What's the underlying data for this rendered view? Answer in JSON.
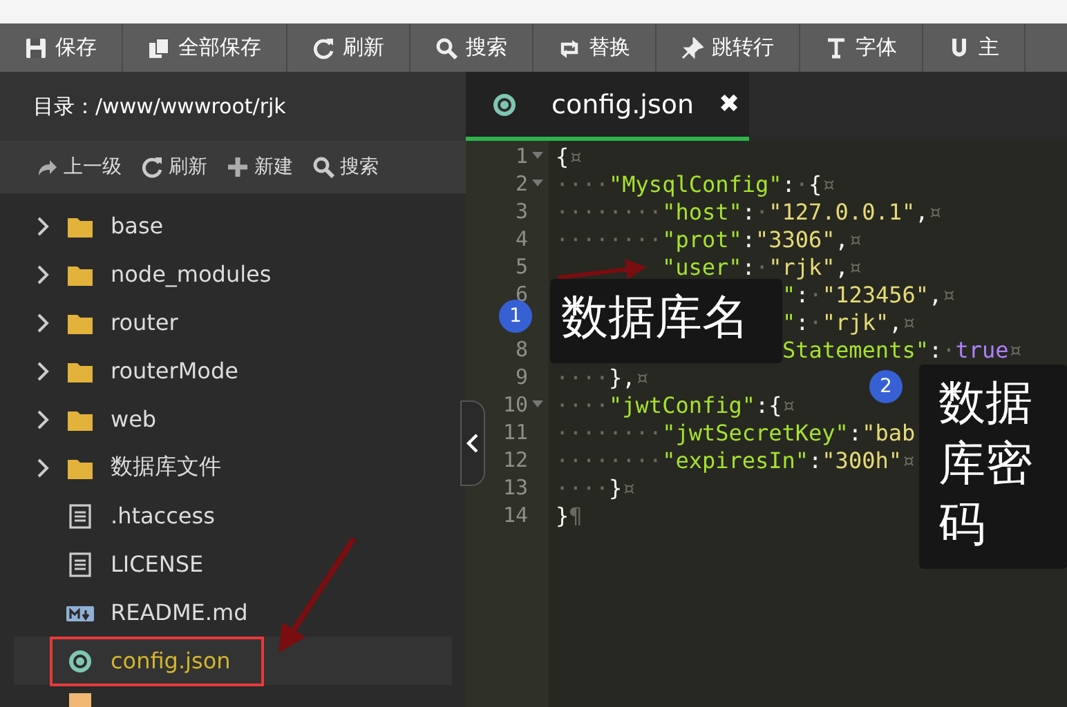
{
  "toolbar": [
    "保存",
    "全部保存",
    "刷新",
    "搜索",
    "替换",
    "跳转行",
    "字体",
    "主"
  ],
  "sidebar": {
    "path": "目录：/www/wwwroot/rjk",
    "actions": [
      "上一级",
      "刷新",
      "新建",
      "搜索"
    ],
    "items": [
      {
        "name": "base",
        "kind": "folder",
        "selected": false
      },
      {
        "name": "node_modules",
        "kind": "folder",
        "selected": false
      },
      {
        "name": "router",
        "kind": "folder",
        "selected": false
      },
      {
        "name": "routerMode",
        "kind": "folder",
        "selected": false
      },
      {
        "name": "web",
        "kind": "folder",
        "selected": false
      },
      {
        "name": "数据库文件",
        "kind": "folder",
        "selected": false
      },
      {
        "name": ".htaccess",
        "kind": "file",
        "selected": false
      },
      {
        "name": "LICENSE",
        "kind": "file",
        "selected": false
      },
      {
        "name": "README.md",
        "kind": "markdown",
        "selected": false
      },
      {
        "name": "config.json",
        "kind": "json",
        "selected": true
      }
    ],
    "more_item": {
      "kind": "js"
    }
  },
  "editor": {
    "tab": {
      "title": "config.json",
      "close": "✖"
    },
    "lines": [
      {
        "n": "1",
        "fold": true,
        "kind": "full",
        "seg": [
          {
            "kind": "punct",
            "text": "{"
          },
          {
            "kind": "ws",
            "text": "¤"
          }
        ]
      },
      {
        "n": "2",
        "fold": true,
        "kind": "full",
        "seg": [
          {
            "kind": "ws",
            "text": "····"
          },
          {
            "kind": "key",
            "text": "\"MysqlConfig\""
          },
          {
            "kind": "punct",
            "text": ":"
          },
          {
            "kind": "ws",
            "text": "·"
          },
          {
            "kind": "punct",
            "text": "{"
          },
          {
            "kind": "ws",
            "text": "¤"
          }
        ]
      },
      {
        "n": "3",
        "fold": false,
        "kind": "full",
        "seg": [
          {
            "kind": "ws",
            "text": "········"
          },
          {
            "kind": "key",
            "text": "\"host\""
          },
          {
            "kind": "punct",
            "text": ":"
          },
          {
            "kind": "ws",
            "text": "·"
          },
          {
            "kind": "str",
            "text": "\"127.0.0.1\""
          },
          {
            "kind": "punct",
            "text": ","
          },
          {
            "kind": "ws",
            "text": "¤"
          }
        ]
      },
      {
        "n": "4",
        "fold": false,
        "kind": "full",
        "seg": [
          {
            "kind": "ws",
            "text": "········"
          },
          {
            "kind": "key",
            "text": "\"prot\""
          },
          {
            "kind": "punct",
            "text": ":"
          },
          {
            "kind": "str",
            "text": "\"3306\""
          },
          {
            "kind": "punct",
            "text": ","
          },
          {
            "kind": "ws",
            "text": "¤"
          }
        ]
      },
      {
        "n": "5",
        "fold": false,
        "kind": "shifted",
        "seg": [
          {
            "kind": "key",
            "text": "\"user\""
          },
          {
            "kind": "punct",
            "text": ":"
          },
          {
            "kind": "ws",
            "text": "·"
          },
          {
            "kind": "str",
            "text": "\"rjk\""
          },
          {
            "kind": "punct",
            "text": ","
          },
          {
            "kind": "ws",
            "text": "¤"
          }
        ]
      },
      {
        "n": "6",
        "fold": false,
        "kind": "covered",
        "seg": [
          {
            "kind": "key",
            "text": "\""
          },
          {
            "kind": "punct",
            "text": ":"
          },
          {
            "kind": "ws",
            "text": "·"
          },
          {
            "kind": "str",
            "text": "\"123456\""
          },
          {
            "kind": "punct",
            "text": ","
          },
          {
            "kind": "ws",
            "text": "¤"
          }
        ]
      },
      {
        "fold": false,
        "kind": "covered",
        "seg": [
          {
            "kind": "key",
            "text": "\""
          },
          {
            "kind": "punct",
            "text": ":"
          },
          {
            "kind": "ws",
            "text": "·"
          },
          {
            "kind": "str",
            "text": "\"rjk\""
          },
          {
            "kind": "punct",
            "text": ","
          },
          {
            "kind": "ws",
            "text": "¤"
          }
        ]
      },
      {
        "n": "8",
        "fold": false,
        "kind": "covered",
        "seg": [
          {
            "kind": "key",
            "text": "Statements\""
          },
          {
            "kind": "punct",
            "text": ":"
          },
          {
            "kind": "ws",
            "text": "·"
          },
          {
            "kind": "const",
            "text": "true"
          },
          {
            "kind": "ws",
            "text": "¤"
          }
        ]
      },
      {
        "n": "9",
        "fold": false,
        "kind": "full",
        "seg": [
          {
            "kind": "ws",
            "text": "····"
          },
          {
            "kind": "punct",
            "text": "},"
          },
          {
            "kind": "ws",
            "text": "¤"
          }
        ]
      },
      {
        "n": "10",
        "fold": true,
        "kind": "full",
        "seg": [
          {
            "kind": "ws",
            "text": "····"
          },
          {
            "kind": "key",
            "text": "\"jwtConfig\""
          },
          {
            "kind": "punct",
            "text": ":"
          },
          {
            "kind": "punct",
            "text": "{"
          },
          {
            "kind": "ws",
            "text": "¤"
          }
        ]
      },
      {
        "n": "11",
        "fold": false,
        "kind": "full",
        "seg": [
          {
            "kind": "ws",
            "text": "········"
          },
          {
            "kind": "key",
            "text": "\"jwtSecretKey\""
          },
          {
            "kind": "punct",
            "text": ":"
          },
          {
            "kind": "str",
            "text": "\"bab"
          }
        ]
      },
      {
        "n": "12",
        "fold": false,
        "kind": "full",
        "seg": [
          {
            "kind": "ws",
            "text": "········"
          },
          {
            "kind": "key",
            "text": "\"expiresIn\""
          },
          {
            "kind": "punct",
            "text": ":"
          },
          {
            "kind": "str",
            "text": "\"300h\""
          },
          {
            "kind": "ws",
            "text": "¤"
          }
        ]
      },
      {
        "n": "13",
        "fold": false,
        "kind": "full",
        "seg": [
          {
            "kind": "ws",
            "text": "····"
          },
          {
            "kind": "punct",
            "text": "}"
          },
          {
            "kind": "ws",
            "text": "¤"
          }
        ]
      },
      {
        "n": "14",
        "fold": false,
        "kind": "full",
        "seg": [
          {
            "kind": "punct",
            "text": "}"
          },
          {
            "kind": "ws",
            "text": "¶"
          }
        ]
      }
    ]
  },
  "annotations": [
    {
      "number": "1",
      "text": "数据库名"
    },
    {
      "number": "2",
      "text": "数据库密码"
    }
  ]
}
